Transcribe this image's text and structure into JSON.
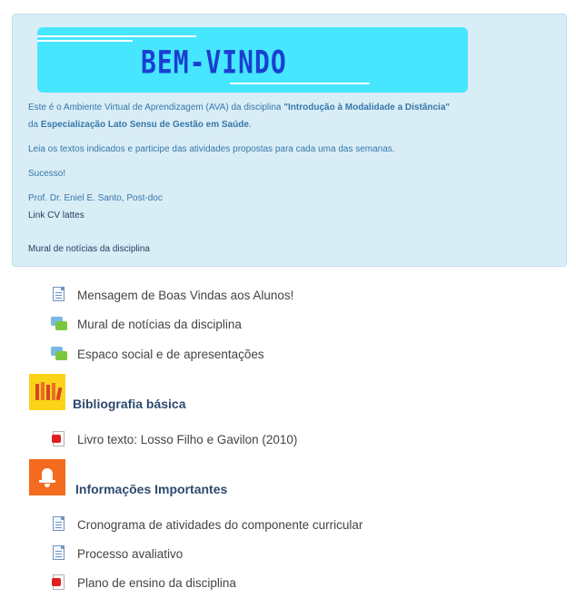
{
  "welcome": {
    "banner_title": "BEM-VINDO",
    "intro_prefix": "Este é o Ambiente Virtual de Aprendizagem (AVA) da disciplina ",
    "course_name": "\"Introdução à Modalidade a Distância\"",
    "intro_da": "da ",
    "specialization": "Especialização Lato Sensu de Gestão em Saúde",
    "intro_suffix": ".",
    "instructions": "Leia os textos indicados e participe das atividades propostas para cada uma das semanas.",
    "success": "Sucesso!",
    "professor": "Prof. Dr. Eniel E. Santo, Post-doc",
    "cv_link": "Link CV lattes",
    "news_link": "Mural de notícias da disciplina"
  },
  "activities": [
    {
      "label": "Mensagem de Boas Vindas aos Alunos!",
      "icon": "page-icon"
    },
    {
      "label": "Mural de notícias da disciplina",
      "icon": "forum-icon"
    },
    {
      "label": "Espaco social e de apresentações",
      "icon": "forum-icon"
    }
  ],
  "sections": [
    {
      "title": "Bibliografia básica",
      "icon": "books-icon",
      "items": [
        {
          "label": "Livro texto: Losso Filho e Gavilon (2010)",
          "icon": "pdf-icon"
        }
      ]
    },
    {
      "title": "Informações Importantes",
      "icon": "bell-icon",
      "items": [
        {
          "label": "Cronograma de atividades do componente curricular",
          "icon": "page-icon"
        },
        {
          "label": "Processo avaliativo",
          "icon": "page-icon"
        },
        {
          "label": "Plano de ensino da disciplina",
          "icon": "pdf-icon"
        }
      ]
    }
  ],
  "colors": {
    "welcome_bg": "#d9edf7",
    "banner_bg": "#46e6ff",
    "banner_text": "#1a3fd0",
    "welcome_text": "#3577a8",
    "section_title": "#2e4a6e"
  }
}
